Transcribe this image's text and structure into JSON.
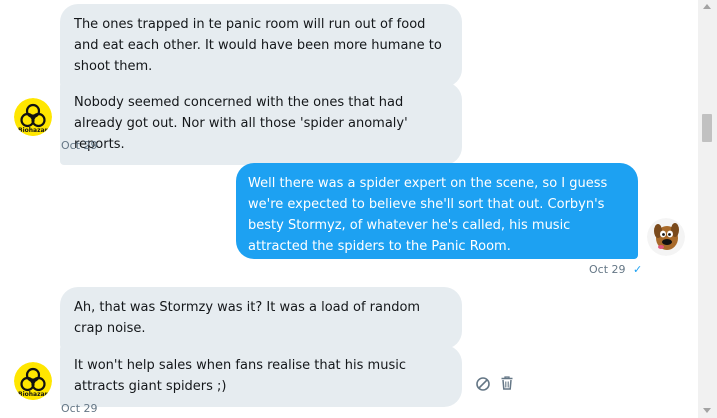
{
  "conversation": {
    "messages": [
      {
        "direction": "incoming",
        "text": "The ones trapped in te panic room will run out of food and eat each other. It would have been more humane to shoot them."
      },
      {
        "direction": "incoming",
        "text": "Nobody seemed concerned with the ones that had already got out. Nor with all those 'spider anomaly' reports."
      },
      {
        "direction": "outgoing",
        "text": "Well there was a spider expert on the scene, so I guess we're expected to believe she'll sort that out. Corbyn's besty Stormyz, of whatever he's called, his music attracted the spiders to the Panic Room."
      },
      {
        "direction": "incoming",
        "text": "Ah, that was Stormzy was it? It was a load of random crap noise."
      },
      {
        "direction": "incoming",
        "text": "It won't help sales when fans realise that his music attracts giant spiders ;)"
      }
    ],
    "timestamps": {
      "group1": "Oct 29",
      "outgoing": "Oct 29",
      "group2": "Oct 29"
    },
    "avatars": {
      "incoming": {
        "icon": "biohazard-icon",
        "caption": "Biohazar",
        "color": "#ffe600"
      },
      "outgoing": {
        "icon": "scooby-doo-icon"
      }
    },
    "read_receipt_icon": "checkmark-icon"
  },
  "actions": {
    "icons": [
      "block-icon",
      "trash-icon"
    ]
  },
  "colors": {
    "incoming_bubble": "#e6ecf0",
    "outgoing_bubble": "#1da1f2",
    "timestamp": "#657786",
    "action_icon": "#657786"
  }
}
